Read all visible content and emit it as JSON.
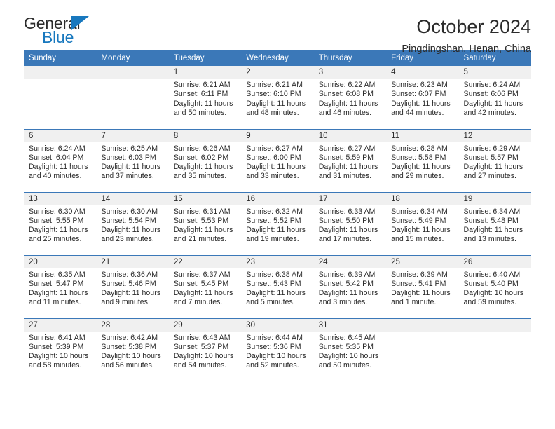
{
  "logo": {
    "word_one": "General",
    "word_two": "Blue",
    "triangle_color": "#1878be",
    "text_color": "#2b2b2b"
  },
  "header": {
    "month_title": "October 2024",
    "location": "Pingdingshan, Henan, China"
  },
  "calendar": {
    "accent_color": "#3b78b8",
    "daynum_band_color": "#f0f0f0",
    "weekday_headers": [
      "Sunday",
      "Monday",
      "Tuesday",
      "Wednesday",
      "Thursday",
      "Friday",
      "Saturday"
    ],
    "labels": {
      "sunrise": "Sunrise:",
      "sunset": "Sunset:",
      "daylight": "Daylight:"
    },
    "weeks": [
      [
        {
          "day": "",
          "lines": []
        },
        {
          "day": "",
          "lines": []
        },
        {
          "day": "1",
          "lines": [
            "Sunrise: 6:21 AM",
            "Sunset: 6:11 PM",
            "Daylight: 11 hours and 50 minutes."
          ]
        },
        {
          "day": "2",
          "lines": [
            "Sunrise: 6:21 AM",
            "Sunset: 6:10 PM",
            "Daylight: 11 hours and 48 minutes."
          ]
        },
        {
          "day": "3",
          "lines": [
            "Sunrise: 6:22 AM",
            "Sunset: 6:08 PM",
            "Daylight: 11 hours and 46 minutes."
          ]
        },
        {
          "day": "4",
          "lines": [
            "Sunrise: 6:23 AM",
            "Sunset: 6:07 PM",
            "Daylight: 11 hours and 44 minutes."
          ]
        },
        {
          "day": "5",
          "lines": [
            "Sunrise: 6:24 AM",
            "Sunset: 6:06 PM",
            "Daylight: 11 hours and 42 minutes."
          ]
        }
      ],
      [
        {
          "day": "6",
          "lines": [
            "Sunrise: 6:24 AM",
            "Sunset: 6:04 PM",
            "Daylight: 11 hours and 40 minutes."
          ]
        },
        {
          "day": "7",
          "lines": [
            "Sunrise: 6:25 AM",
            "Sunset: 6:03 PM",
            "Daylight: 11 hours and 37 minutes."
          ]
        },
        {
          "day": "8",
          "lines": [
            "Sunrise: 6:26 AM",
            "Sunset: 6:02 PM",
            "Daylight: 11 hours and 35 minutes."
          ]
        },
        {
          "day": "9",
          "lines": [
            "Sunrise: 6:27 AM",
            "Sunset: 6:00 PM",
            "Daylight: 11 hours and 33 minutes."
          ]
        },
        {
          "day": "10",
          "lines": [
            "Sunrise: 6:27 AM",
            "Sunset: 5:59 PM",
            "Daylight: 11 hours and 31 minutes."
          ]
        },
        {
          "day": "11",
          "lines": [
            "Sunrise: 6:28 AM",
            "Sunset: 5:58 PM",
            "Daylight: 11 hours and 29 minutes."
          ]
        },
        {
          "day": "12",
          "lines": [
            "Sunrise: 6:29 AM",
            "Sunset: 5:57 PM",
            "Daylight: 11 hours and 27 minutes."
          ]
        }
      ],
      [
        {
          "day": "13",
          "lines": [
            "Sunrise: 6:30 AM",
            "Sunset: 5:55 PM",
            "Daylight: 11 hours and 25 minutes."
          ]
        },
        {
          "day": "14",
          "lines": [
            "Sunrise: 6:30 AM",
            "Sunset: 5:54 PM",
            "Daylight: 11 hours and 23 minutes."
          ]
        },
        {
          "day": "15",
          "lines": [
            "Sunrise: 6:31 AM",
            "Sunset: 5:53 PM",
            "Daylight: 11 hours and 21 minutes."
          ]
        },
        {
          "day": "16",
          "lines": [
            "Sunrise: 6:32 AM",
            "Sunset: 5:52 PM",
            "Daylight: 11 hours and 19 minutes."
          ]
        },
        {
          "day": "17",
          "lines": [
            "Sunrise: 6:33 AM",
            "Sunset: 5:50 PM",
            "Daylight: 11 hours and 17 minutes."
          ]
        },
        {
          "day": "18",
          "lines": [
            "Sunrise: 6:34 AM",
            "Sunset: 5:49 PM",
            "Daylight: 11 hours and 15 minutes."
          ]
        },
        {
          "day": "19",
          "lines": [
            "Sunrise: 6:34 AM",
            "Sunset: 5:48 PM",
            "Daylight: 11 hours and 13 minutes."
          ]
        }
      ],
      [
        {
          "day": "20",
          "lines": [
            "Sunrise: 6:35 AM",
            "Sunset: 5:47 PM",
            "Daylight: 11 hours and 11 minutes."
          ]
        },
        {
          "day": "21",
          "lines": [
            "Sunrise: 6:36 AM",
            "Sunset: 5:46 PM",
            "Daylight: 11 hours and 9 minutes."
          ]
        },
        {
          "day": "22",
          "lines": [
            "Sunrise: 6:37 AM",
            "Sunset: 5:45 PM",
            "Daylight: 11 hours and 7 minutes."
          ]
        },
        {
          "day": "23",
          "lines": [
            "Sunrise: 6:38 AM",
            "Sunset: 5:43 PM",
            "Daylight: 11 hours and 5 minutes."
          ]
        },
        {
          "day": "24",
          "lines": [
            "Sunrise: 6:39 AM",
            "Sunset: 5:42 PM",
            "Daylight: 11 hours and 3 minutes."
          ]
        },
        {
          "day": "25",
          "lines": [
            "Sunrise: 6:39 AM",
            "Sunset: 5:41 PM",
            "Daylight: 11 hours and 1 minute."
          ]
        },
        {
          "day": "26",
          "lines": [
            "Sunrise: 6:40 AM",
            "Sunset: 5:40 PM",
            "Daylight: 10 hours and 59 minutes."
          ]
        }
      ],
      [
        {
          "day": "27",
          "lines": [
            "Sunrise: 6:41 AM",
            "Sunset: 5:39 PM",
            "Daylight: 10 hours and 58 minutes."
          ]
        },
        {
          "day": "28",
          "lines": [
            "Sunrise: 6:42 AM",
            "Sunset: 5:38 PM",
            "Daylight: 10 hours and 56 minutes."
          ]
        },
        {
          "day": "29",
          "lines": [
            "Sunrise: 6:43 AM",
            "Sunset: 5:37 PM",
            "Daylight: 10 hours and 54 minutes."
          ]
        },
        {
          "day": "30",
          "lines": [
            "Sunrise: 6:44 AM",
            "Sunset: 5:36 PM",
            "Daylight: 10 hours and 52 minutes."
          ]
        },
        {
          "day": "31",
          "lines": [
            "Sunrise: 6:45 AM",
            "Sunset: 5:35 PM",
            "Daylight: 10 hours and 50 minutes."
          ]
        },
        {
          "day": "",
          "lines": []
        },
        {
          "day": "",
          "lines": []
        }
      ]
    ]
  }
}
